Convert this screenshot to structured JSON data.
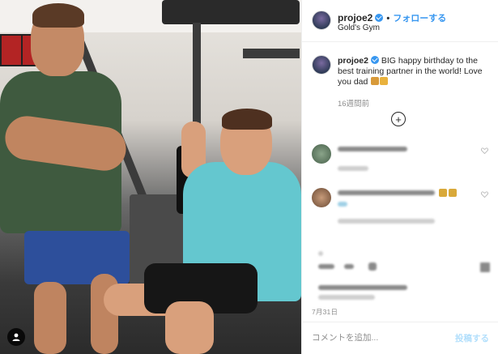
{
  "header": {
    "username": "projoe2",
    "separator": "•",
    "follow_label": "フォローする",
    "location": "Gold's Gym"
  },
  "caption": {
    "username": "projoe2",
    "text": "BIG happy birthday to the best training partner in the world! Love you dad",
    "time_ago": "16週間前"
  },
  "post": {
    "date": "7月31日"
  },
  "comment_box": {
    "placeholder": "コメントを追加...",
    "post_label": "投稿する"
  },
  "icons": {
    "verified": "verified-badge-icon",
    "load_more": "plus-circle-icon",
    "user_tag": "user-tag-icon",
    "like": "heart-icon",
    "emoji_1": "flexed-biceps-emoji",
    "emoji_2": "party-popper-emoji"
  },
  "colors": {
    "link_blue": "#3897f0",
    "post_button_disabled": "#b2dffc",
    "secondary_text": "#8e8e8e",
    "divider": "#efefef"
  }
}
